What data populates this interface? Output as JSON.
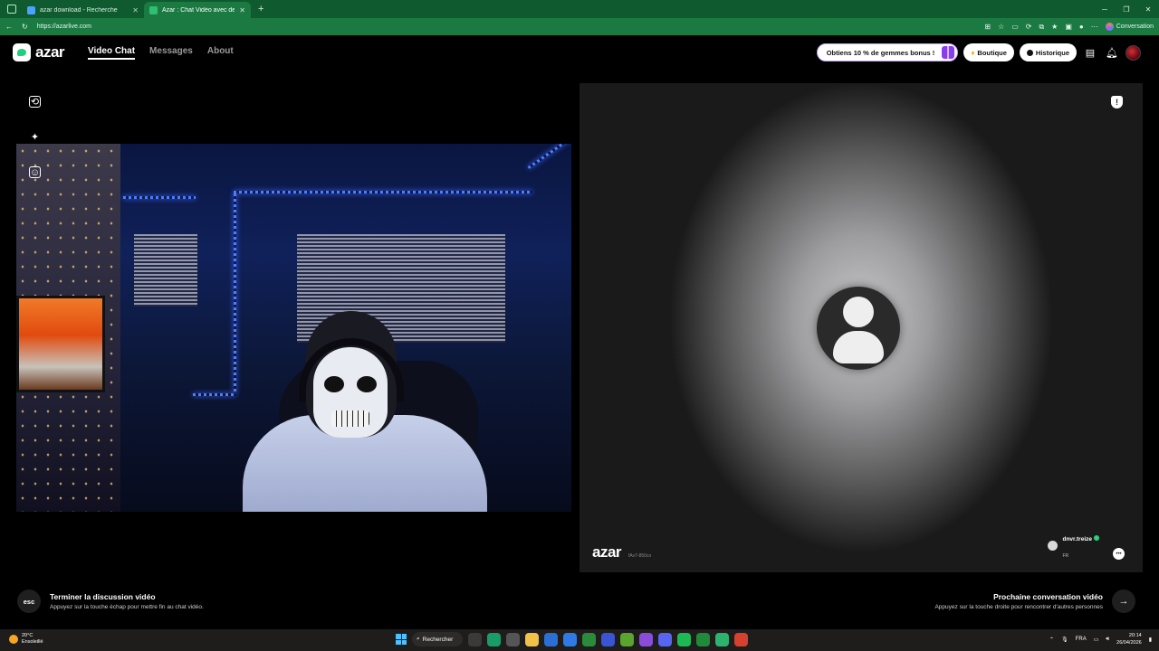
{
  "browser": {
    "tabs": [
      {
        "title": "azar download - Recherche",
        "active": false
      },
      {
        "title": "Azar : Chat Vidéo avec de nc",
        "active": true
      }
    ],
    "url": "https://azarlive.com",
    "conversation_label": "Conversation"
  },
  "app": {
    "logo_text": "azar",
    "nav": {
      "video_chat": "Video Chat",
      "messages": "Messages",
      "about": "About"
    },
    "promo_label": "Obtiens 10 % de gemmes bonus !",
    "boutique_label": "Boutique",
    "historique_label": "Historique",
    "accent_color": "#1ecf7c",
    "promo_accent": "#8a3cf0"
  },
  "left_pane": {
    "icons": [
      "camera-switch-icon",
      "magic-wand-icon",
      "sticker-icon"
    ]
  },
  "right_pane": {
    "watermark_logo": "azar",
    "watermark_id": "fAv7-850co",
    "partner_name": "dnvr.treize",
    "partner_country": "FR",
    "icons": [
      "report-shield-icon",
      "avatar-placeholder-icon",
      "chat-bubble-icon"
    ]
  },
  "footer": {
    "esc_key": "esc",
    "end_title": "Terminer la discussion vidéo",
    "end_sub": "Appuyez sur la touche échap pour mettre fin au chat vidéo.",
    "next_title": "Prochaine conversation vidéo",
    "next_sub": "Appuyez sur la touche droite pour rencontrer d'autres personnes",
    "next_arrow": "→"
  },
  "taskbar": {
    "temp": "20°C",
    "weather": "Ensoleillé",
    "search": "Rechercher",
    "lang": "FRA",
    "time": "20:14",
    "date": "26/04/2026"
  }
}
